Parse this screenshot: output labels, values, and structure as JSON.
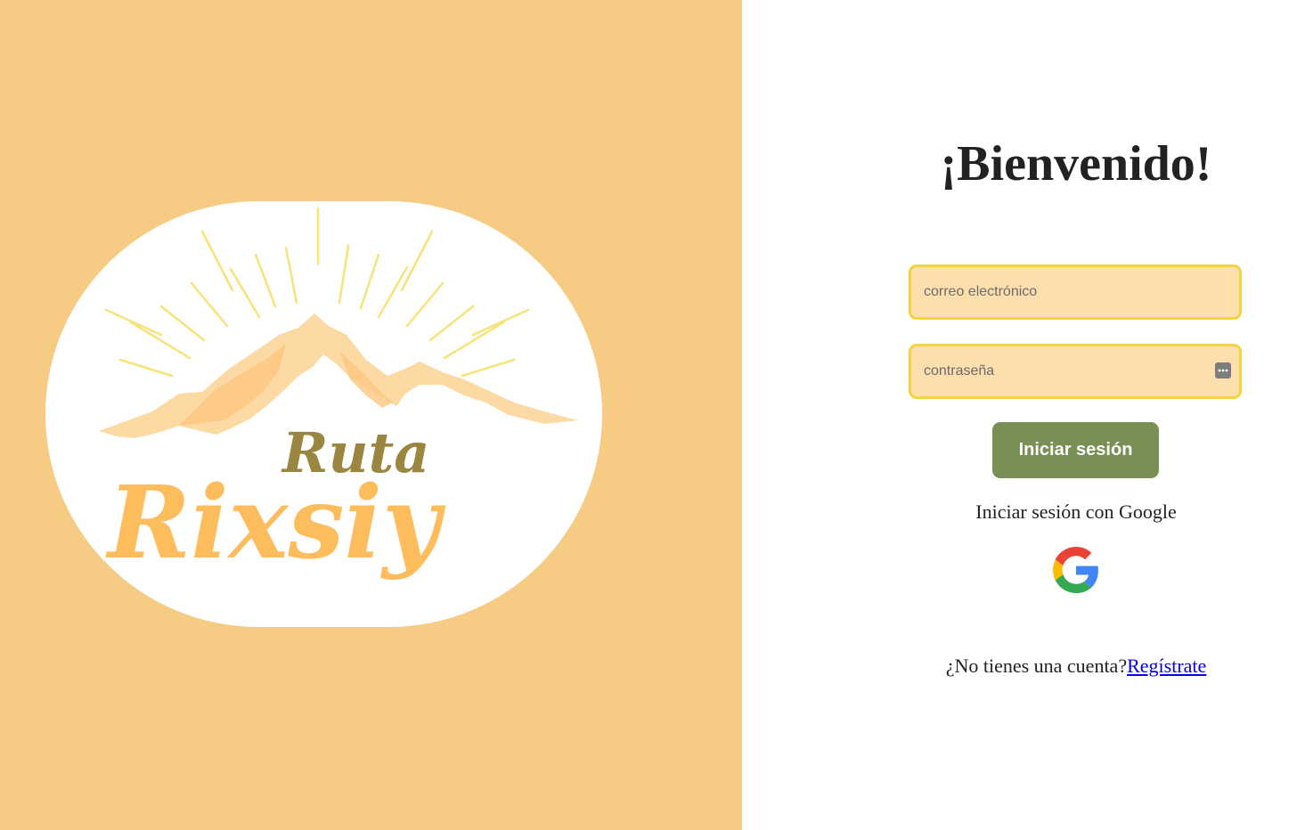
{
  "brand": {
    "logo_text_line1": "Ruta",
    "logo_text_line2": "Rixsiy",
    "panel_color": "#f6cc84"
  },
  "login": {
    "title": "¡Bienvenido!",
    "email_placeholder": "correo electrónico",
    "password_placeholder": "contraseña",
    "submit_label": "Iniciar sesión",
    "google_label": "Iniciar sesión con Google",
    "google_icon": "google-icon",
    "signup_prompt": "¿No tienes una cuenta?",
    "signup_link": "Regístrate",
    "accent_button": "#799055",
    "field_bg": "#fddfae",
    "field_border": "#f3d43f"
  }
}
